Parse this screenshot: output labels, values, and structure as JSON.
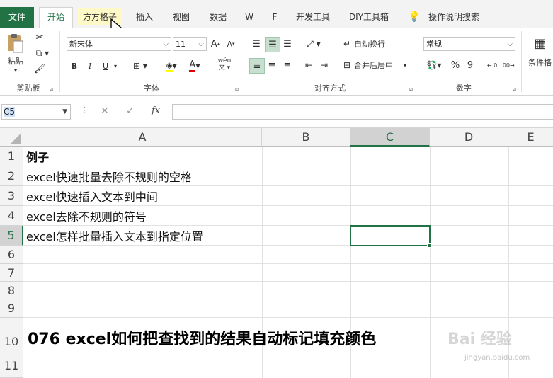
{
  "tabs": [
    {
      "label": "文件"
    },
    {
      "label": "开始"
    },
    {
      "label": "方方格子"
    },
    {
      "label": "插入"
    },
    {
      "label": "视图"
    },
    {
      "label": "数据"
    },
    {
      "label": "W"
    },
    {
      "label": "F"
    },
    {
      "label": "开发工具"
    },
    {
      "label": "DIY工具箱"
    },
    {
      "label": "操作说明搜索"
    }
  ],
  "ribbon": {
    "clipboard": {
      "paste": "粘贴",
      "label": "剪贴板"
    },
    "font": {
      "name": "新宋体",
      "size": "11",
      "bold": "B",
      "italic": "I",
      "underline": "U",
      "grow": "A",
      "shrink": "A",
      "label": "字体",
      "phonetic": "wén"
    },
    "alignment": {
      "wrap": "自动换行",
      "merge": "合并后居中",
      "label": "对齐方式"
    },
    "number": {
      "format": "常规",
      "percent": "%",
      "comma": "9",
      "label": "数字"
    },
    "styles": {
      "cond": "条件格"
    }
  },
  "formula_bar": {
    "name_box": "C5",
    "cancel": "✕",
    "enter": "✓",
    "fx": "fx",
    "value": ""
  },
  "columns": [
    "A",
    "B",
    "C",
    "D",
    "E"
  ],
  "active_column": "C",
  "rows": [
    "1",
    "2",
    "3",
    "4",
    "5",
    "6",
    "7",
    "8",
    "9",
    "10",
    "11"
  ],
  "active_row": "5",
  "cells": {
    "A1": "例子",
    "A2": "excel快速批量去除不规则的空格",
    "A3": "excel快速插入文本到中间",
    "A4": "excel去除不规则的符号",
    "A5": "excel怎样批量插入文本到指定位置"
  },
  "caption": "076 excel如何把查找到的结果自动标记填充颜色",
  "watermark": {
    "main": "Bai 经验",
    "sub": "jingyan.baidu.com"
  },
  "colors": {
    "accent": "#217346"
  }
}
